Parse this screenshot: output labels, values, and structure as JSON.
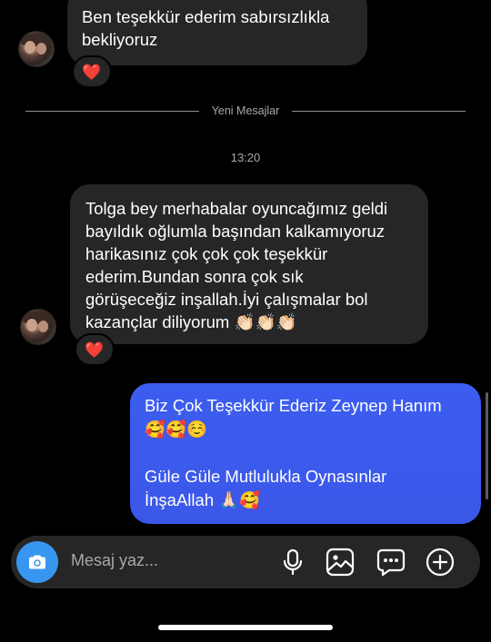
{
  "messages_in": [
    {
      "text": "Ben teşekkür ederim sabırsızlıkla\nbekliyoruz",
      "reaction": "❤️"
    },
    {
      "text": "Tolga bey merhabalar oyuncağımız geldi\nbayıldık oğlumla başından kalkamıyoruz\nharikasınız çok çok çok teşekkür\nederim.Bundan sonra çok sık\ngörüşeceğiz inşallah.İyi çalışmalar bol\nkazançlar diliyorum 👏🏻👏🏻👏🏻",
      "reaction": "❤️"
    }
  ],
  "divider_label": "Yeni Mesajlar",
  "timestamp": "13:20",
  "message_out": {
    "line1": "Biz Çok Teşekkür Ederiz Zeynep Hanım",
    "line2": "🥰🥰☺️",
    "line3": "Güle Güle Mutlulukla Oynasınlar",
    "line4": "İnşaAllah 🙏🏻🥰"
  },
  "composer": {
    "placeholder": "Mesaj yaz..."
  },
  "icons": {
    "camera": "camera-icon",
    "mic": "microphone-icon",
    "gallery": "gallery-icon",
    "sticker": "chat-sticker-icon",
    "plus": "plus-circle-icon"
  },
  "colors": {
    "background": "#000000",
    "incoming_bubble": "#262626",
    "outgoing_bubble": "#3c5df0",
    "accent": "#3797f0",
    "secondary_text": "#a8a8a8"
  }
}
